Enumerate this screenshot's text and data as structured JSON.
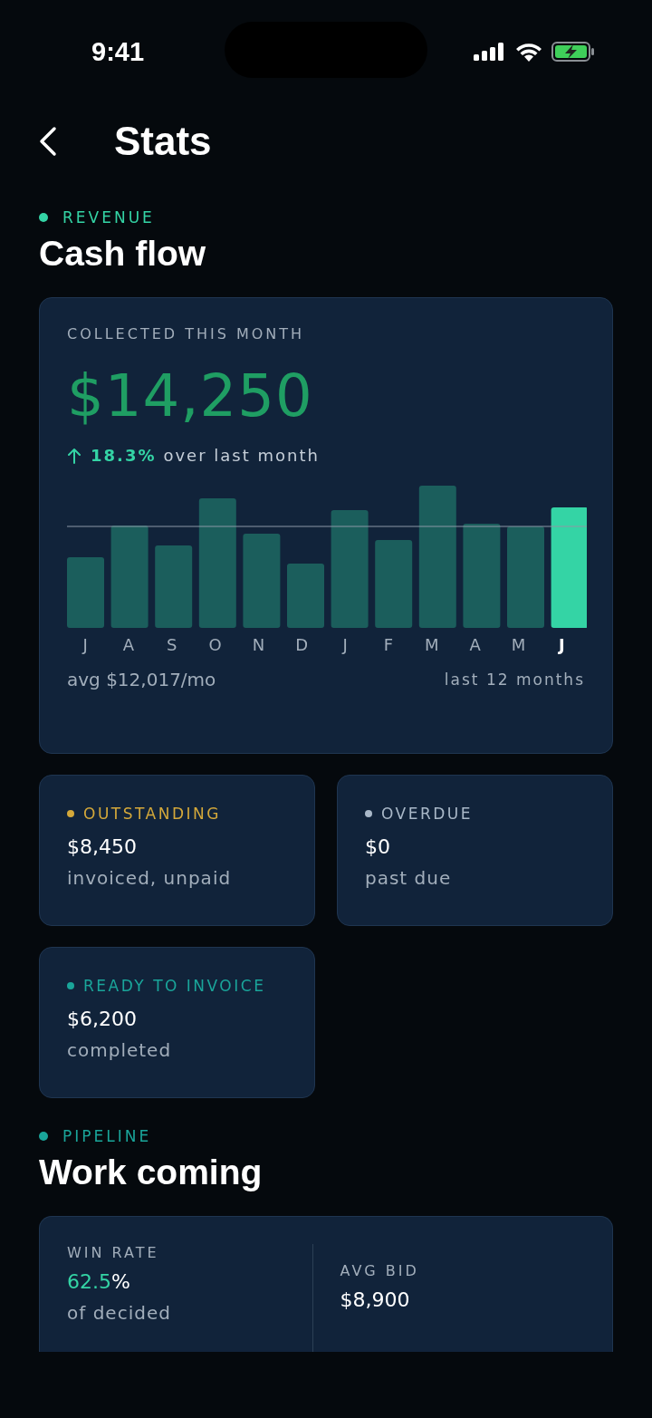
{
  "status_bar": {
    "time": "9:41"
  },
  "header": {
    "title": "Stats"
  },
  "sections": [
    {
      "kind": "revenue",
      "eyebrow": "REVENUE",
      "title": "Cash flow",
      "color": "#34d4a5",
      "summary": {
        "label": "COLLECTED THIS MONTH",
        "amount": "$14,250",
        "change": "18.3%",
        "change_text": "over last month",
        "months": [
          {
            "label": "J",
            "selected": false
          },
          {
            "label": "A",
            "selected": false
          },
          {
            "label": "S",
            "selected": false
          },
          {
            "label": "O",
            "selected": false
          },
          {
            "label": "N",
            "selected": false
          },
          {
            "label": "D",
            "selected": false
          },
          {
            "label": "J",
            "selected": false
          },
          {
            "label": "F",
            "selected": false
          },
          {
            "label": "M",
            "selected": false
          },
          {
            "label": "A",
            "selected": false
          },
          {
            "label": "M",
            "selected": false
          },
          {
            "label": "J",
            "selected": true
          }
        ],
        "average": "avg $12,017/mo",
        "period": "last 12 months"
      },
      "cards": [
        {
          "label": "OUTSTANDING",
          "color": "#d4a83a",
          "amount": "$8,450",
          "note": "invoiced, unpaid"
        },
        {
          "label": "OVERDUE",
          "color": "#a9b8c8",
          "amount": "$0",
          "note": "past due"
        },
        {
          "label": "READY TO INVOICE",
          "color": "#1aa59a",
          "amount": "$6,200",
          "note": "completed"
        }
      ]
    },
    {
      "kind": "pipeline",
      "eyebrow": "PIPELINE",
      "title": "Work coming",
      "color": "#1aa59a",
      "stats": [
        {
          "label": "WIN RATE",
          "value": "62.5",
          "unit": "%",
          "note": "of decided"
        },
        {
          "label": "AVG BID",
          "value": "$8,900"
        }
      ]
    }
  ]
}
